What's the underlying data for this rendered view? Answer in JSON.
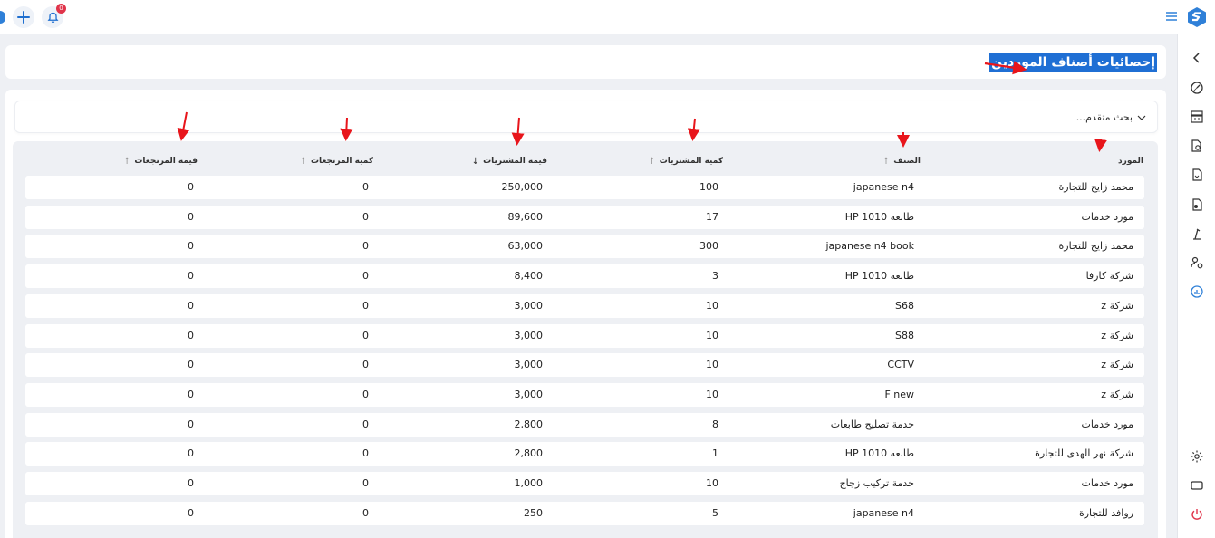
{
  "topbar": {
    "notification_count": "0"
  },
  "page": {
    "title": "إحصائيات أصناف الموردين"
  },
  "advanced_search": {
    "label": "بحث متقدم..."
  },
  "table": {
    "columns": [
      {
        "label": "المورد"
      },
      {
        "label": "الصنف"
      },
      {
        "label": "كمية المشتريات"
      },
      {
        "label": "قيمة المشتريات"
      },
      {
        "label": "كمية المرتجعات"
      },
      {
        "label": "قيمة المرتجعات"
      }
    ],
    "rows": [
      {
        "supplier": "محمد زايح للتجارة",
        "item": "japanese n4",
        "qty": "100",
        "value": "250,000",
        "ret_qty": "0",
        "ret_value": "0"
      },
      {
        "supplier": "مورد خدمات",
        "item": "طابعه HP 1010",
        "qty": "17",
        "value": "89,600",
        "ret_qty": "0",
        "ret_value": "0"
      },
      {
        "supplier": "محمد زايح للتجارة",
        "item": "japanese n4 book",
        "qty": "300",
        "value": "63,000",
        "ret_qty": "0",
        "ret_value": "0"
      },
      {
        "supplier": "شركة كارفا",
        "item": "طابعه HP 1010",
        "qty": "3",
        "value": "8,400",
        "ret_qty": "0",
        "ret_value": "0"
      },
      {
        "supplier": "شركة z",
        "item": "S68",
        "qty": "10",
        "value": "3,000",
        "ret_qty": "0",
        "ret_value": "0"
      },
      {
        "supplier": "شركة z",
        "item": "S88",
        "qty": "10",
        "value": "3,000",
        "ret_qty": "0",
        "ret_value": "0"
      },
      {
        "supplier": "شركة z",
        "item": "CCTV",
        "qty": "10",
        "value": "3,000",
        "ret_qty": "0",
        "ret_value": "0"
      },
      {
        "supplier": "شركة z",
        "item": "F new",
        "qty": "10",
        "value": "3,000",
        "ret_qty": "0",
        "ret_value": "0"
      },
      {
        "supplier": "مورد خدمات",
        "item": "خدمة تصليح طابعات",
        "qty": "8",
        "value": "2,800",
        "ret_qty": "0",
        "ret_value": "0"
      },
      {
        "supplier": "شركة  نهر الهدى للتجارة",
        "item": "طابعه HP 1010",
        "qty": "1",
        "value": "2,800",
        "ret_qty": "0",
        "ret_value": "0"
      },
      {
        "supplier": "مورد خدمات",
        "item": "خدمة تركيب زجاج",
        "qty": "10",
        "value": "1,000",
        "ret_qty": "0",
        "ret_value": "0"
      },
      {
        "supplier": "روافد للتجارة",
        "item": "japanese n4",
        "qty": "5",
        "value": "250",
        "ret_qty": "0",
        "ret_value": "0"
      }
    ]
  },
  "colors": {
    "accent": "#1f6fd4",
    "annotation": "#e8151b",
    "badge": "#e0344a"
  }
}
